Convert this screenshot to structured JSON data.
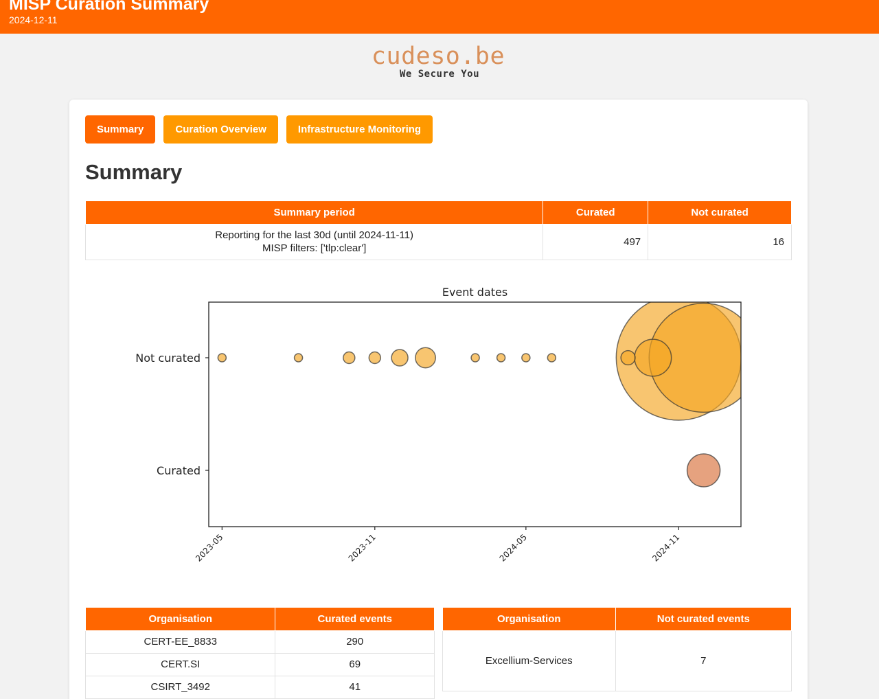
{
  "header": {
    "title": "MISP Curation Summary",
    "date": "2024-12-11"
  },
  "logo": {
    "brand": "cudeso.be",
    "tagline": "We Secure You"
  },
  "tabs": [
    {
      "label": "Summary",
      "active": true
    },
    {
      "label": "Curation Overview",
      "active": false
    },
    {
      "label": "Infrastructure Monitoring",
      "active": false
    }
  ],
  "page_title": "Summary",
  "summary_table": {
    "headers": [
      "Summary period",
      "Curated",
      "Not curated"
    ],
    "period_line1": "Reporting for the last 30d (until 2024-11-11)",
    "period_line2": "MISP filters: ['tlp:clear']",
    "curated": "497",
    "not_curated": "16"
  },
  "colors": {
    "accent": "#ff6600",
    "accent_light": "#ff9900",
    "bubble_not_curated": "#f5a623",
    "bubble_curated": "#d9703a"
  },
  "chart_data": {
    "type": "scatter",
    "title": "Event dates",
    "categories": [
      "Curated",
      "Not curated"
    ],
    "xlim": [
      "2023-04-15",
      "2025-01-15"
    ],
    "xticks": [
      "2023-05",
      "2023-11",
      "2024-05",
      "2024-11"
    ],
    "series": [
      {
        "category": "Not curated",
        "points": [
          {
            "date": "2023-05-01",
            "count": 1
          },
          {
            "date": "2023-08-01",
            "count": 1
          },
          {
            "date": "2023-10-01",
            "count": 2
          },
          {
            "date": "2023-11-01",
            "count": 2
          },
          {
            "date": "2023-12-01",
            "count": 4
          },
          {
            "date": "2024-01-01",
            "count": 6
          },
          {
            "date": "2024-03-01",
            "count": 1
          },
          {
            "date": "2024-04-01",
            "count": 1
          },
          {
            "date": "2024-05-01",
            "count": 1
          },
          {
            "date": "2024-06-01",
            "count": 1
          },
          {
            "date": "2024-09-01",
            "count": 3
          },
          {
            "date": "2024-10-01",
            "count": 20
          },
          {
            "date": "2024-11-01",
            "count": 230
          },
          {
            "date": "2024-12-01",
            "count": 175
          }
        ]
      },
      {
        "category": "Curated",
        "points": [
          {
            "date": "2024-12-01",
            "count": 16
          }
        ]
      }
    ]
  },
  "org_curated": {
    "headers": [
      "Organisation",
      "Curated events"
    ],
    "rows": [
      {
        "org": "CERT-EE_8833",
        "count": "290"
      },
      {
        "org": "CERT.SI",
        "count": "69"
      },
      {
        "org": "CSIRT_3492",
        "count": "41"
      }
    ]
  },
  "org_not_curated": {
    "headers": [
      "Organisation",
      "Not curated events"
    ],
    "rows": [
      {
        "org": "Excellium-Services",
        "count": "7"
      }
    ]
  }
}
